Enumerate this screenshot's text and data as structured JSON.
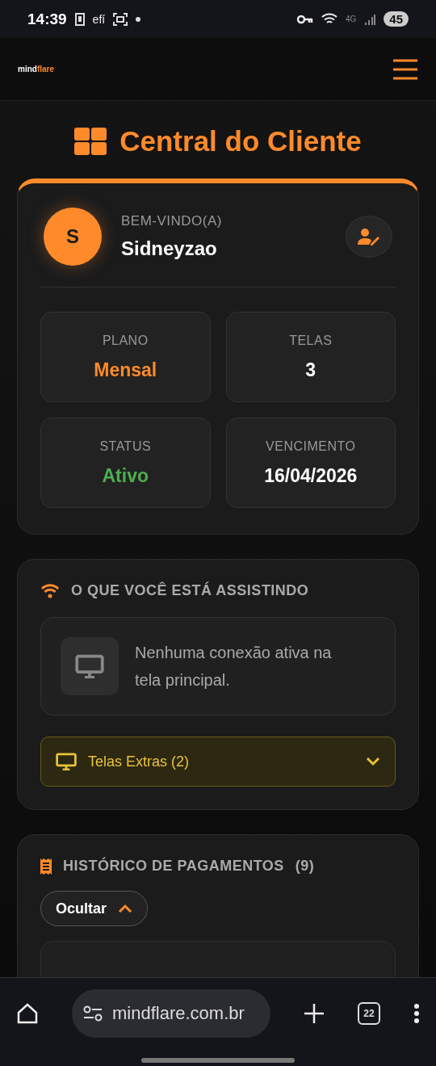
{
  "status_bar": {
    "time": "14:39",
    "app_label": "efí",
    "network": "4G",
    "battery": "45"
  },
  "header": {
    "logo": [
      "mind",
      "flare"
    ]
  },
  "page_title": "Central do Cliente",
  "profile": {
    "avatar": "S",
    "greeting": "BEM-VINDO(A)",
    "name": "Sidneyzao",
    "stats": [
      {
        "label": "PLANO",
        "value": "Mensal",
        "color": "#ff8a2a"
      },
      {
        "label": "TELAS",
        "value": "3",
        "color": "#ffffff"
      },
      {
        "label": "STATUS",
        "value": "Ativo",
        "color": "#4caf50"
      },
      {
        "label": "VENCIMENTO",
        "value": "16/04/2026",
        "color": "#ffffff"
      }
    ]
  },
  "watching": {
    "title": "O QUE VOCÊ ESTÁ ASSISTINDO",
    "message": "Nenhuma conexão ativa na tela principal.",
    "extras": {
      "label": "Telas Extras (2)",
      "expanded": false
    }
  },
  "payments": {
    "title": "HISTÓRICO DE PAGAMENTOS",
    "count": "(9)",
    "toggle": {
      "label": "Ocultar",
      "expanded": true
    }
  },
  "browser": {
    "url": "mindflare.com.br",
    "tabs": "22"
  }
}
